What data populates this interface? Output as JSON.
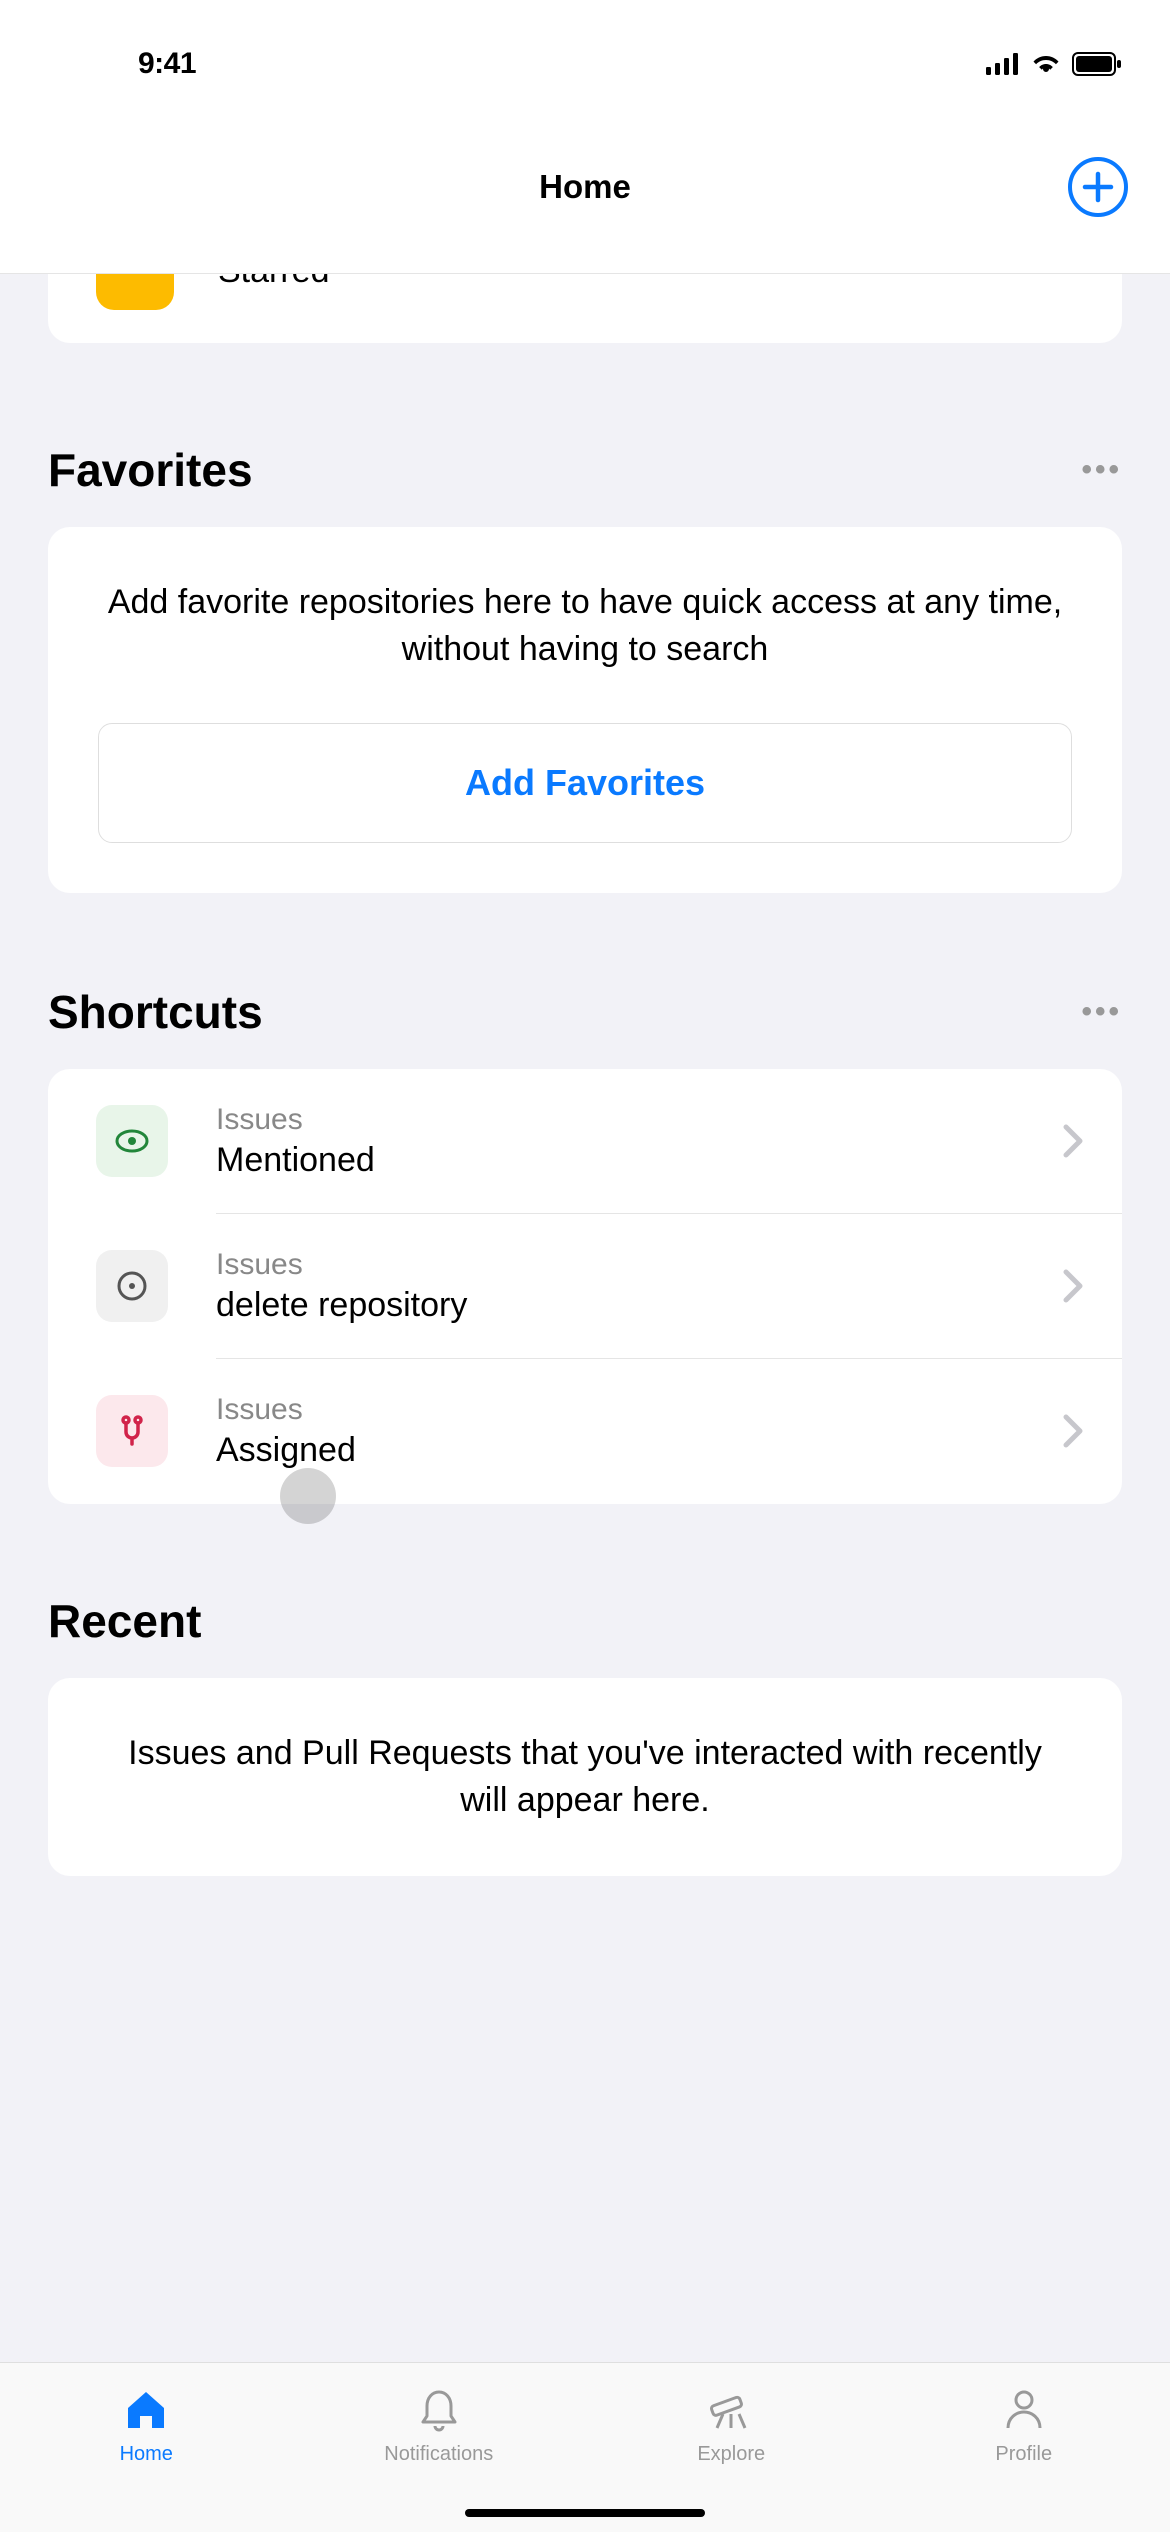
{
  "status": {
    "time": "9:41"
  },
  "nav": {
    "title": "Home"
  },
  "peek": {
    "label": "Starred"
  },
  "sections": {
    "favorites": {
      "title": "Favorites",
      "text": "Add favorite repositories here to have quick access at any time, without having to search",
      "button": "Add Favorites"
    },
    "shortcuts": {
      "title": "Shortcuts"
    },
    "recent": {
      "title": "Recent",
      "text": "Issues and Pull Requests that you've interacted with recently will appear here."
    }
  },
  "shortcuts": [
    {
      "category": "Issues",
      "name": "Mentioned"
    },
    {
      "category": "Issues",
      "name": "delete repository"
    },
    {
      "category": "Issues",
      "name": "Assigned"
    }
  ],
  "tabs": {
    "home": "Home",
    "notifications": "Notifications",
    "explore": "Explore",
    "profile": "Profile"
  },
  "colors": {
    "accent": "#0a7aff",
    "star": "#fdbb00",
    "eye_bg": "#e8f5e9",
    "eye_fg": "#22863a",
    "issue_bg": "#f0f0f0",
    "issue_fg": "#555",
    "assigned_bg": "#fce8ec",
    "assigned_fg": "#d1234a"
  }
}
